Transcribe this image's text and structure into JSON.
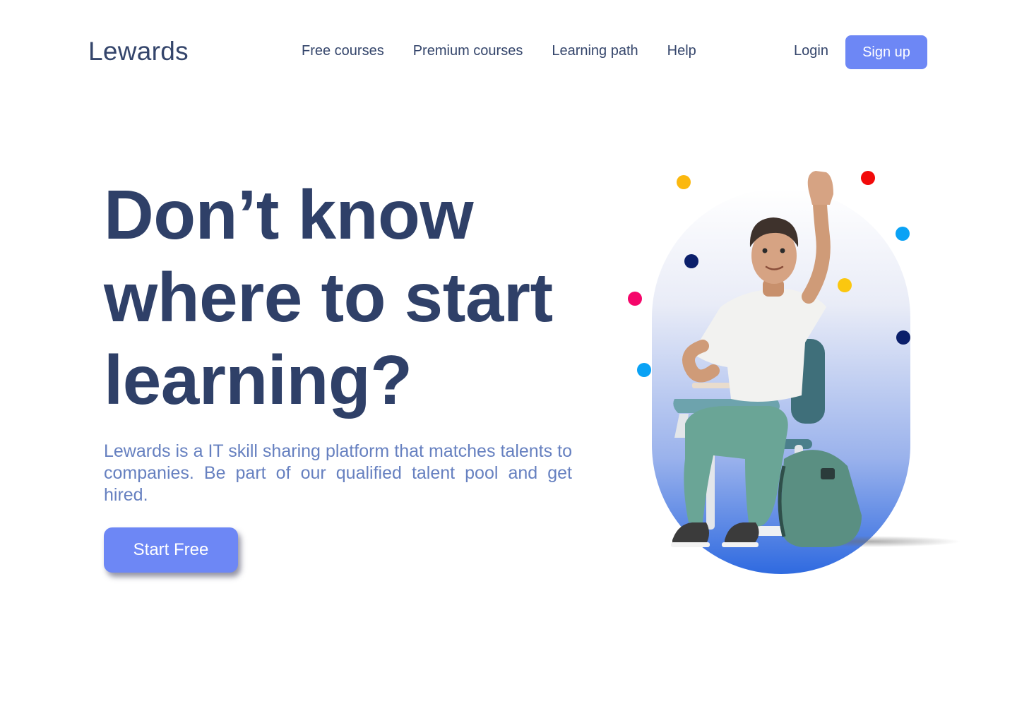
{
  "header": {
    "logo": "Lewards",
    "nav": [
      {
        "label": "Free courses"
      },
      {
        "label": "Premium courses"
      },
      {
        "label": "Learning path"
      },
      {
        "label": "Help"
      }
    ],
    "login_label": "Login",
    "signup_label": "Sign up"
  },
  "hero": {
    "headline_lines": [
      "Don’t know",
      "where to start",
      "learning?"
    ],
    "description": "Lewards is a IT skill sharing platform that matches talents to companies. Be part of our qualified talent pool and get hired.",
    "cta_label": "Start Free"
  },
  "colors": {
    "brand": "#6d87f5",
    "heading": "#2f4068",
    "body_text": "#6680c0",
    "nav_text": "#34456b",
    "confetti": [
      "#fbb80f",
      "#f20a0a",
      "#0aa2f5",
      "#0b1f6b",
      "#f5066a"
    ]
  }
}
